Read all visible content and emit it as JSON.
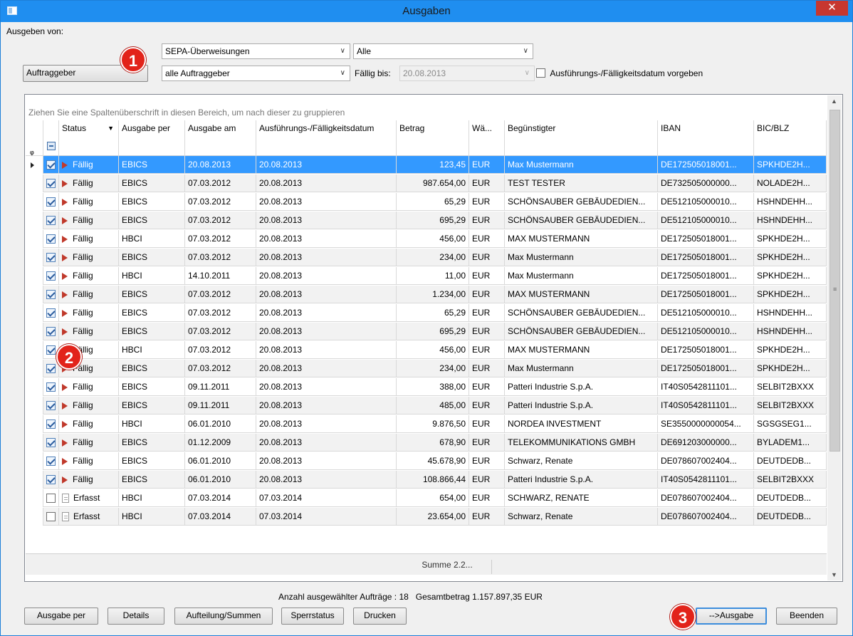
{
  "window": {
    "title": "Ausgaben",
    "close": "✕"
  },
  "filters": {
    "ausgeben_von_label": "Ausgeben von:",
    "type_select": "SEPA-Überweisungen",
    "scope_select": "Alle",
    "principal_button": "Auftraggeber",
    "principal_select": "alle Auftraggeber",
    "due_label": "Fällig bis:",
    "due_date": "20.08.2013",
    "set_date_checkbox_label": "Ausführungs-/Fälligkeitsdatum vorgeben"
  },
  "grid": {
    "group_hint": "Ziehen Sie eine Spaltenüberschrift in diesen Bereich, um nach dieser zu gruppieren",
    "columns": [
      "Status",
      "Ausgabe per",
      "Ausgabe am",
      "Ausführungs-/Fälligkeitsdatum",
      "Betrag",
      "Wä...",
      "Begünstigter",
      "IBAN",
      "BIC/BLZ"
    ],
    "rows": [
      {
        "checked": true,
        "status": "Fällig",
        "per": "EBICS",
        "am": "20.08.2013",
        "faellig": "20.08.2013",
        "betrag": "123,45",
        "wae": "EUR",
        "beg": "Max Mustermann",
        "iban": "DE172505018001...",
        "bic": "SPKHDE2H..."
      },
      {
        "checked": true,
        "status": "Fällig",
        "per": "EBICS",
        "am": "07.03.2012",
        "faellig": "20.08.2013",
        "betrag": "987.654,00",
        "wae": "EUR",
        "beg": "TEST TESTER",
        "iban": "DE732505000000...",
        "bic": "NOLADE2H..."
      },
      {
        "checked": true,
        "status": "Fällig",
        "per": "EBICS",
        "am": "07.03.2012",
        "faellig": "20.08.2013",
        "betrag": "65,29",
        "wae": "EUR",
        "beg": "SCHÖNSAUBER GEBÄUDEDIEN...",
        "iban": "DE512105000010...",
        "bic": "HSHNDEHH..."
      },
      {
        "checked": true,
        "status": "Fällig",
        "per": "EBICS",
        "am": "07.03.2012",
        "faellig": "20.08.2013",
        "betrag": "695,29",
        "wae": "EUR",
        "beg": "SCHÖNSAUBER GEBÄUDEDIEN...",
        "iban": "DE512105000010...",
        "bic": "HSHNDEHH..."
      },
      {
        "checked": true,
        "status": "Fällig",
        "per": "HBCI",
        "am": "07.03.2012",
        "faellig": "20.08.2013",
        "betrag": "456,00",
        "wae": "EUR",
        "beg": "MAX MUSTERMANN",
        "iban": "DE172505018001...",
        "bic": "SPKHDE2H..."
      },
      {
        "checked": true,
        "status": "Fällig",
        "per": "EBICS",
        "am": "07.03.2012",
        "faellig": "20.08.2013",
        "betrag": "234,00",
        "wae": "EUR",
        "beg": "Max Mustermann",
        "iban": "DE172505018001...",
        "bic": "SPKHDE2H..."
      },
      {
        "checked": true,
        "status": "Fällig",
        "per": "HBCI",
        "am": "14.10.2011",
        "faellig": "20.08.2013",
        "betrag": "11,00",
        "wae": "EUR",
        "beg": "Max Mustermann",
        "iban": "DE172505018001...",
        "bic": "SPKHDE2H..."
      },
      {
        "checked": true,
        "status": "Fällig",
        "per": "EBICS",
        "am": "07.03.2012",
        "faellig": "20.08.2013",
        "betrag": "1.234,00",
        "wae": "EUR",
        "beg": "MAX MUSTERMANN",
        "iban": "DE172505018001...",
        "bic": "SPKHDE2H..."
      },
      {
        "checked": true,
        "status": "Fällig",
        "per": "EBICS",
        "am": "07.03.2012",
        "faellig": "20.08.2013",
        "betrag": "65,29",
        "wae": "EUR",
        "beg": "SCHÖNSAUBER GEBÄUDEDIEN...",
        "iban": "DE512105000010...",
        "bic": "HSHNDEHH..."
      },
      {
        "checked": true,
        "status": "Fällig",
        "per": "EBICS",
        "am": "07.03.2012",
        "faellig": "20.08.2013",
        "betrag": "695,29",
        "wae": "EUR",
        "beg": "SCHÖNSAUBER GEBÄUDEDIEN...",
        "iban": "DE512105000010...",
        "bic": "HSHNDEHH..."
      },
      {
        "checked": true,
        "status": "Fällig",
        "per": "HBCI",
        "am": "07.03.2012",
        "faellig": "20.08.2013",
        "betrag": "456,00",
        "wae": "EUR",
        "beg": "MAX MUSTERMANN",
        "iban": "DE172505018001...",
        "bic": "SPKHDE2H..."
      },
      {
        "checked": true,
        "status": "Fällig",
        "per": "EBICS",
        "am": "07.03.2012",
        "faellig": "20.08.2013",
        "betrag": "234,00",
        "wae": "EUR",
        "beg": "Max Mustermann",
        "iban": "DE172505018001...",
        "bic": "SPKHDE2H..."
      },
      {
        "checked": true,
        "status": "Fällig",
        "per": "EBICS",
        "am": "09.11.2011",
        "faellig": "20.08.2013",
        "betrag": "388,00",
        "wae": "EUR",
        "beg": "Patteri Industrie S.p.A.",
        "iban": "IT40S0542811101...",
        "bic": "SELBIT2BXXX"
      },
      {
        "checked": true,
        "status": "Fällig",
        "per": "EBICS",
        "am": "09.11.2011",
        "faellig": "20.08.2013",
        "betrag": "485,00",
        "wae": "EUR",
        "beg": "Patteri Industrie S.p.A.",
        "iban": "IT40S0542811101...",
        "bic": "SELBIT2BXXX"
      },
      {
        "checked": true,
        "status": "Fällig",
        "per": "HBCI",
        "am": "06.01.2010",
        "faellig": "20.08.2013",
        "betrag": "9.876,50",
        "wae": "EUR",
        "beg": "NORDEA INVESTMENT",
        "iban": "SE3550000000054...",
        "bic": "SGSGSEG1..."
      },
      {
        "checked": true,
        "status": "Fällig",
        "per": "EBICS",
        "am": "01.12.2009",
        "faellig": "20.08.2013",
        "betrag": "678,90",
        "wae": "EUR",
        "beg": "TELEKOMMUNIKATIONS GMBH",
        "iban": "DE691203000000...",
        "bic": "BYLADEM1..."
      },
      {
        "checked": true,
        "status": "Fällig",
        "per": "EBICS",
        "am": "06.01.2010",
        "faellig": "20.08.2013",
        "betrag": "45.678,90",
        "wae": "EUR",
        "beg": "Schwarz, Renate",
        "iban": "DE078607002404...",
        "bic": "DEUTDEDB..."
      },
      {
        "checked": true,
        "status": "Fällig",
        "per": "EBICS",
        "am": "06.01.2010",
        "faellig": "20.08.2013",
        "betrag": "108.866,44",
        "wae": "EUR",
        "beg": "Patteri Industrie S.p.A.",
        "iban": "IT40S0542811101...",
        "bic": "SELBIT2BXXX"
      },
      {
        "checked": false,
        "status": "Erfasst",
        "per": "HBCI",
        "am": "07.03.2014",
        "faellig": "07.03.2014",
        "betrag": "654,00",
        "wae": "EUR",
        "beg": "SCHWARZ, RENATE",
        "iban": "DE078607002404...",
        "bic": "DEUTDEDB..."
      },
      {
        "checked": false,
        "status": "Erfasst",
        "per": "HBCI",
        "am": "07.03.2014",
        "faellig": "07.03.2014",
        "betrag": "23.654,00",
        "wae": "EUR",
        "beg": "Schwarz, Renate",
        "iban": "DE078607002404...",
        "bic": "DEUTDEDB..."
      }
    ],
    "summary": "Summe 2.2..."
  },
  "footer": {
    "status_text": "Anzahl ausgewählter Aufträge : 18   Gesamtbetrag 1.157.897,35 EUR",
    "buttons": {
      "ausgabe_per": "Ausgabe per",
      "details": "Details",
      "aufteilung": "Aufteilung/Summen",
      "sperrstatus": "Sperrstatus",
      "drucken": "Drucken",
      "ausgabe": "-->Ausgabe",
      "beenden": "Beenden"
    }
  },
  "badges": [
    "1",
    "2",
    "3"
  ]
}
